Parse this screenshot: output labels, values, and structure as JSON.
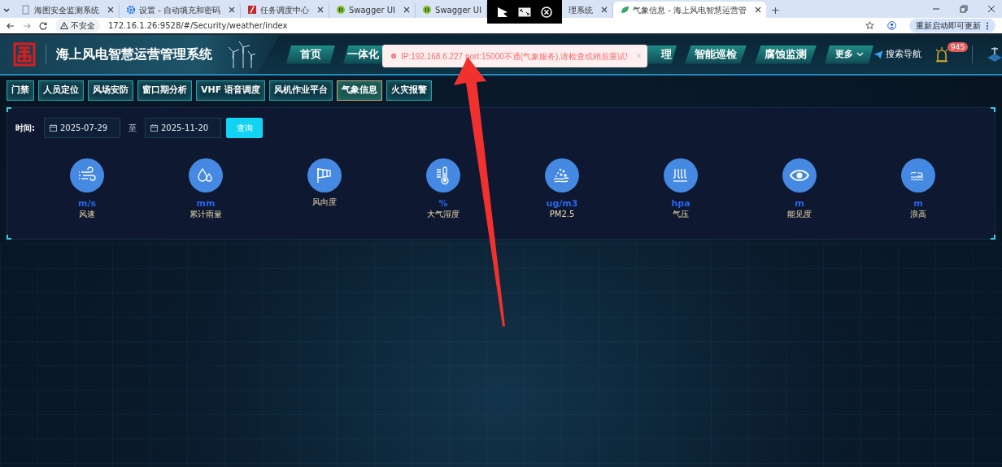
{
  "browser": {
    "tabs": [
      {
        "title": "海图安全监测系统",
        "selected": false,
        "kind": "page"
      },
      {
        "title": "设置 - 自动填充和密码",
        "selected": false,
        "kind": "gear"
      },
      {
        "title": "任务调度中心",
        "selected": false,
        "kind": "slash"
      },
      {
        "title": "Swagger UI",
        "selected": false,
        "kind": "swagger"
      },
      {
        "title": "Swagger UI",
        "selected": false,
        "kind": "swagger",
        "close": false
      },
      {
        "title": "理系统",
        "selected": false,
        "kind": "partial"
      },
      {
        "title": "气象信息 - 海上风电智慧运营管",
        "selected": true,
        "kind": "leaf"
      }
    ],
    "new_tab": "+",
    "security": "不安全",
    "url": "172.16.1.26:9528/#/Security/weather/index",
    "update_button": "重新启动即可更新"
  },
  "app": {
    "title": "海上风电智慧运营管理系统",
    "nav": [
      {
        "label": "首页",
        "kind": "full"
      },
      {
        "label": "一体化",
        "kind": "covered-right"
      },
      {
        "label": "理",
        "kind": "covered-left"
      },
      {
        "label": "智能巡检",
        "kind": "full"
      },
      {
        "label": "腐蚀监测",
        "kind": "full"
      },
      {
        "label": "更多",
        "kind": "menu"
      }
    ],
    "search_nav": "搜索导航",
    "alarm_count": "945"
  },
  "subnav": [
    {
      "label": "门禁",
      "selected": false
    },
    {
      "label": "人员定位",
      "selected": false
    },
    {
      "label": "风场安防",
      "selected": false
    },
    {
      "label": "窗口期分析",
      "selected": false
    },
    {
      "label": "VHF 语音调度",
      "selected": false
    },
    {
      "label": "风机作业平台",
      "selected": false
    },
    {
      "label": "气象信息",
      "selected": true
    },
    {
      "label": "火灾报警",
      "selected": false
    }
  ],
  "filter": {
    "label": "时间:",
    "start": "2025-07-29",
    "separator": "至",
    "end": "2025-11-20",
    "button": "查询"
  },
  "metrics": [
    {
      "kind": "wind",
      "unit": "m/s",
      "label": "风速"
    },
    {
      "kind": "rain",
      "unit": "mm",
      "label": "累计雨量"
    },
    {
      "kind": "wind_direction",
      "label": "风向度"
    },
    {
      "kind": "humidity",
      "unit": "%",
      "label": "大气湿度"
    },
    {
      "kind": "pm25",
      "unit": "ug/m3",
      "label": "PM2.5"
    },
    {
      "kind": "pressure",
      "unit": "hpa",
      "label": "气压"
    },
    {
      "kind": "visibility",
      "unit": "m",
      "label": "能见度"
    },
    {
      "kind": "wave",
      "unit": "m",
      "label": "浪高"
    }
  ],
  "toast": {
    "message": "IP:192.168.6.227 port:15000不通(气象服务),请检查或稍后重试!",
    "close": "×"
  }
}
